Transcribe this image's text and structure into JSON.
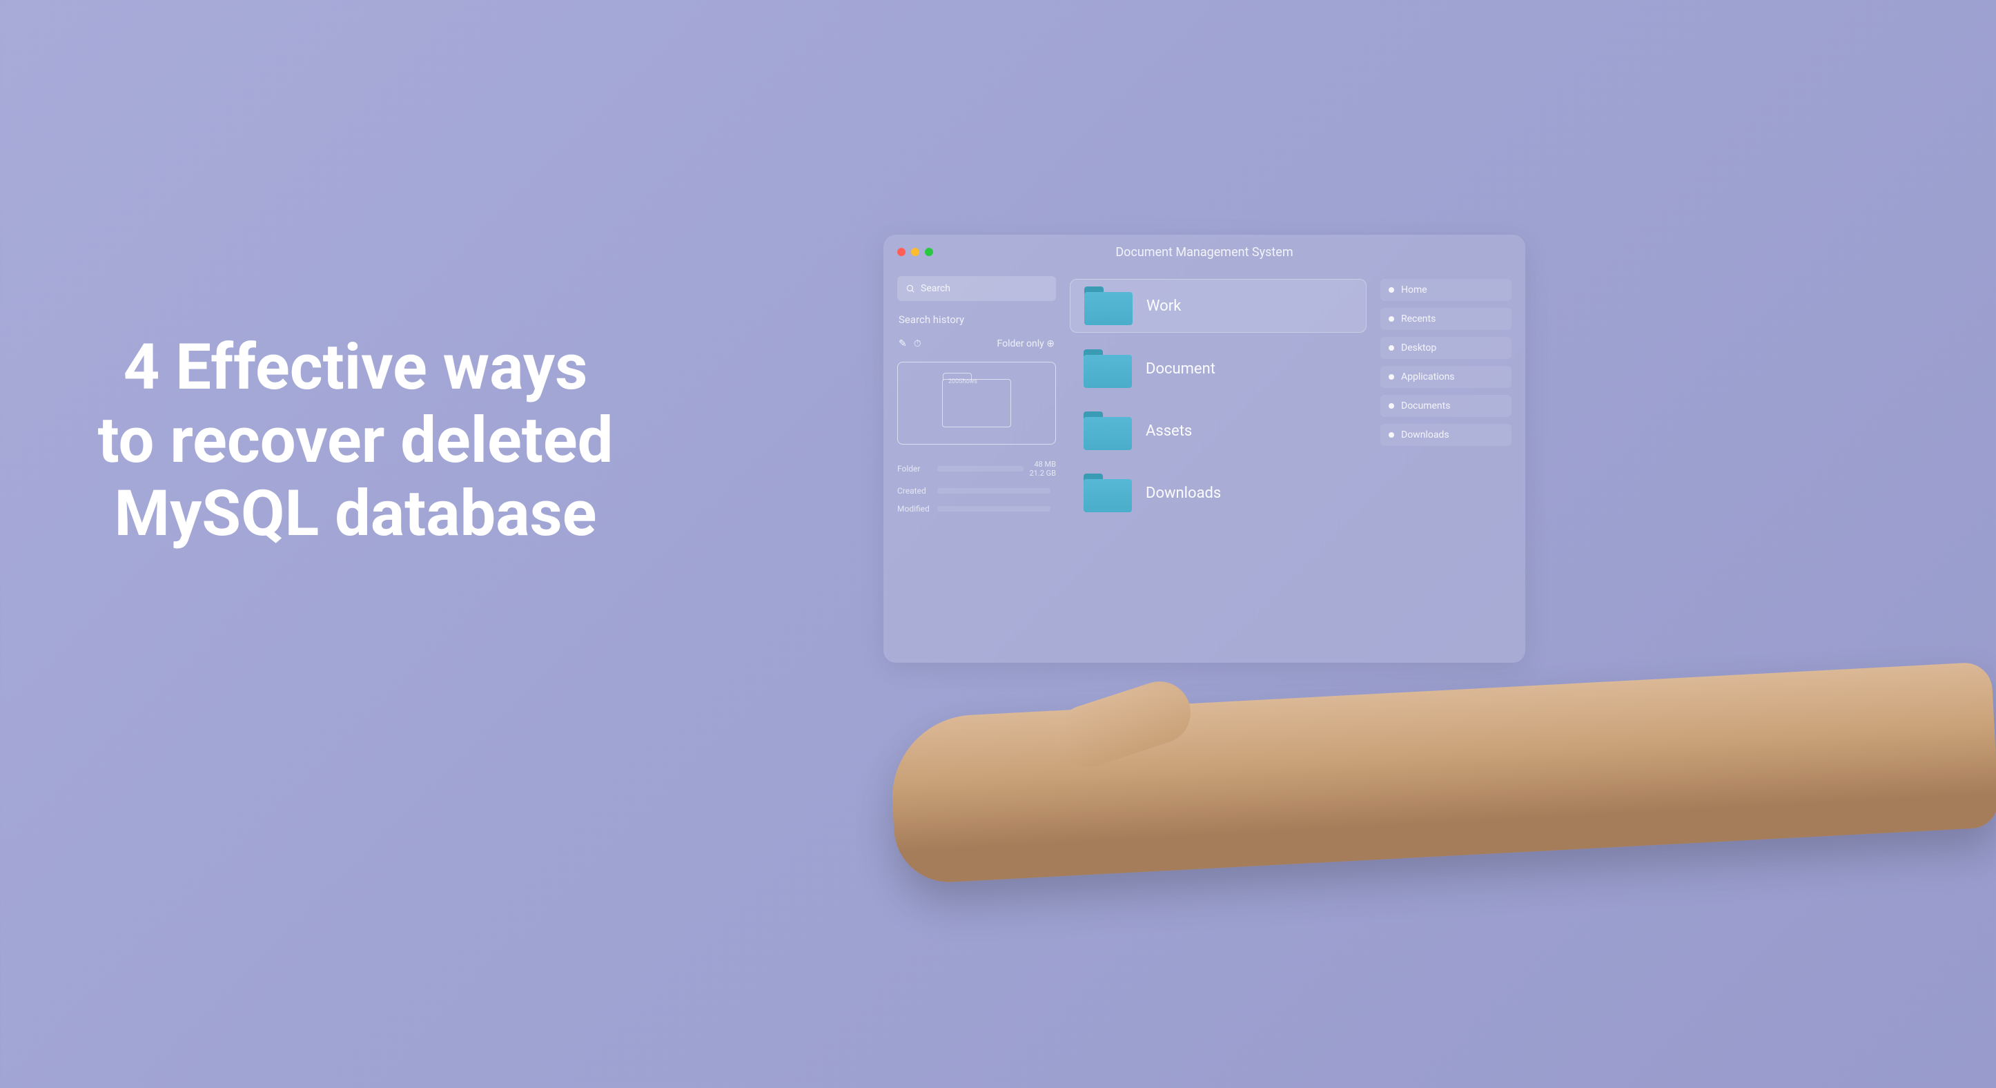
{
  "title": "4 Effective ways to recover deleted MySQL database",
  "window": {
    "title": "Document Management System",
    "search": {
      "placeholder": "Search"
    },
    "searchHistory": "Search history",
    "folderOnly": "Folder only",
    "folderPreviewName": "200Shows",
    "meta": {
      "row1": {
        "label": "Folder",
        "right1": "48 MB",
        "right2": "21.2 GB"
      },
      "row2": {
        "label": "Created"
      },
      "row3": {
        "label": "Modified"
      }
    },
    "folders": [
      {
        "label": "Work",
        "selected": true
      },
      {
        "label": "Document",
        "selected": false
      },
      {
        "label": "Assets",
        "selected": false
      },
      {
        "label": "Downloads",
        "selected": false
      }
    ],
    "nav": [
      {
        "label": "Home"
      },
      {
        "label": "Recents"
      },
      {
        "label": "Desktop"
      },
      {
        "label": "Applications"
      },
      {
        "label": "Documents"
      },
      {
        "label": "Downloads"
      }
    ]
  }
}
